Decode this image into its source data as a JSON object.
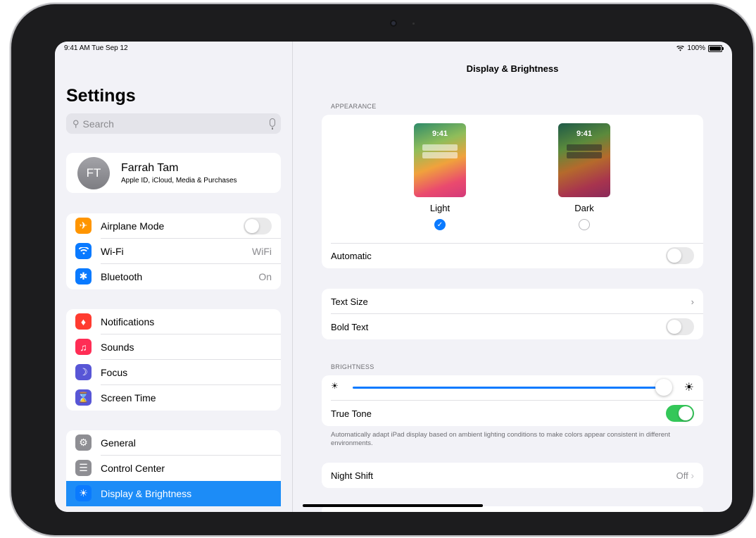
{
  "status_bar": {
    "time": "9:41 AM  Tue Sep 12",
    "battery": "100%"
  },
  "sidebar": {
    "title": "Settings",
    "search_placeholder": "Search",
    "profile": {
      "initials": "FT",
      "name": "Farrah Tam",
      "subtitle": "Apple ID, iCloud, Media & Purchases"
    },
    "group1": [
      {
        "label": "Airplane Mode",
        "icon": "airplane-icon",
        "color": "#ff9500",
        "toggle": false
      },
      {
        "label": "Wi-Fi",
        "icon": "wifi-icon",
        "color": "#0a7aff",
        "value": "WiFi"
      },
      {
        "label": "Bluetooth",
        "icon": "bluetooth-icon",
        "color": "#0a7aff",
        "value": "On"
      }
    ],
    "group2": [
      {
        "label": "Notifications",
        "icon": "bell-icon",
        "color": "#ff3b30"
      },
      {
        "label": "Sounds",
        "icon": "speaker-icon",
        "color": "#ff2d55"
      },
      {
        "label": "Focus",
        "icon": "moon-icon",
        "color": "#5856d6"
      },
      {
        "label": "Screen Time",
        "icon": "hourglass-icon",
        "color": "#5856d6"
      }
    ],
    "group3": [
      {
        "label": "General",
        "icon": "gear-icon",
        "color": "#8e8e93"
      },
      {
        "label": "Control Center",
        "icon": "switches-icon",
        "color": "#8e8e93"
      },
      {
        "label": "Display & Brightness",
        "icon": "sun-icon",
        "color": "#0a7aff",
        "selected": true
      }
    ]
  },
  "main": {
    "title": "Display & Brightness",
    "appearance_header": "APPEARANCE",
    "light": {
      "clock": "9:41",
      "label": "Light",
      "selected": true
    },
    "dark": {
      "clock": "9:41",
      "label": "Dark",
      "selected": false
    },
    "automatic_label": "Automatic",
    "automatic_on": false,
    "text_size_label": "Text Size",
    "bold_text_label": "Bold Text",
    "bold_text_on": false,
    "brightness_header": "BRIGHTNESS",
    "brightness_level": 0.98,
    "true_tone_label": "True Tone",
    "true_tone_on": true,
    "true_tone_footnote": "Automatically adapt iPad display based on ambient lighting conditions to make colors appear consistent in different environments.",
    "night_shift_label": "Night Shift",
    "night_shift_value": "Off"
  }
}
